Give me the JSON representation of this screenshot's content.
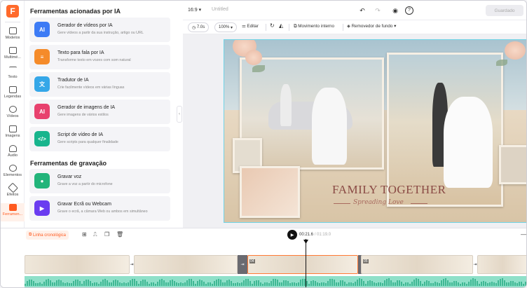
{
  "rail": {
    "items": [
      {
        "label": "Modelos",
        "icon": "template-icon"
      },
      {
        "label": "Multimé...",
        "icon": "media-icon"
      },
      {
        "label": "Texto",
        "icon": "text-icon"
      },
      {
        "label": "Legendas",
        "icon": "subtitles-icon"
      },
      {
        "label": "Vídeos",
        "icon": "video-icon"
      },
      {
        "label": "Imagens",
        "icon": "image-icon"
      },
      {
        "label": "Áudio",
        "icon": "audio-icon"
      },
      {
        "label": "Elementos",
        "icon": "elements-icon"
      },
      {
        "label": "Efeitos",
        "icon": "effects-icon"
      },
      {
        "label": "Ferramen...",
        "icon": "toolbox-icon",
        "active": true
      }
    ]
  },
  "panel": {
    "ai_section_title": "Ferramentas acionadas por IA",
    "recording_section_title": "Ferramentas de gravação",
    "ai_tools": [
      {
        "title": "Gerador de vídeos por IA",
        "desc": "Gere vídeos a partir da sua instrução, artigo ou URL",
        "color": "#3d7bf5",
        "glyph": "AI"
      },
      {
        "title": "Texto para fala por IA",
        "desc": "Transforme texto em vozes com som natural",
        "color": "#f58b2a",
        "glyph": "≡"
      },
      {
        "title": "Tradutor de IA",
        "desc": "Crie facilmente vídeos em várias línguas",
        "color": "#35a7e8",
        "glyph": "文"
      },
      {
        "title": "Gerador de imagens de IA",
        "desc": "Gere imagens de vários estilos",
        "color": "#e8416e",
        "glyph": "AI"
      },
      {
        "title": "Script de vídeo de IA",
        "desc": "Gere scripts para qualquer finalidade",
        "color": "#18b58d",
        "glyph": "</>"
      }
    ],
    "recording_tools": [
      {
        "title": "Gravar voz",
        "desc": "Grave a voz a partir do microfone",
        "color": "#22b47a",
        "glyph": "🎙"
      },
      {
        "title": "Gravar Ecrã ou Webcam",
        "desc": "Grave o ecrã, a câmara Web ou ambos em simultâneo",
        "color": "#6a3cf0",
        "glyph": "▶"
      }
    ]
  },
  "topbar": {
    "ratio": "16:9",
    "title_placeholder": "Untitled",
    "save_label": "Guardado"
  },
  "edit_toolbar": {
    "duration": "7.0s",
    "zoom": "100%",
    "edit_label": "Editar",
    "motion_label": "Movimento interno",
    "bg_remover_label": "Removedor de fundo"
  },
  "canvas": {
    "title": "FAMILY TOGETHER",
    "subtitle": "Spreading Love"
  },
  "timeline": {
    "tag": "Linha cronológica",
    "current_time": "00:21.6",
    "total_time": "/ 01:19.0",
    "selected_clip_number": "04",
    "next_clip_number": "05"
  }
}
